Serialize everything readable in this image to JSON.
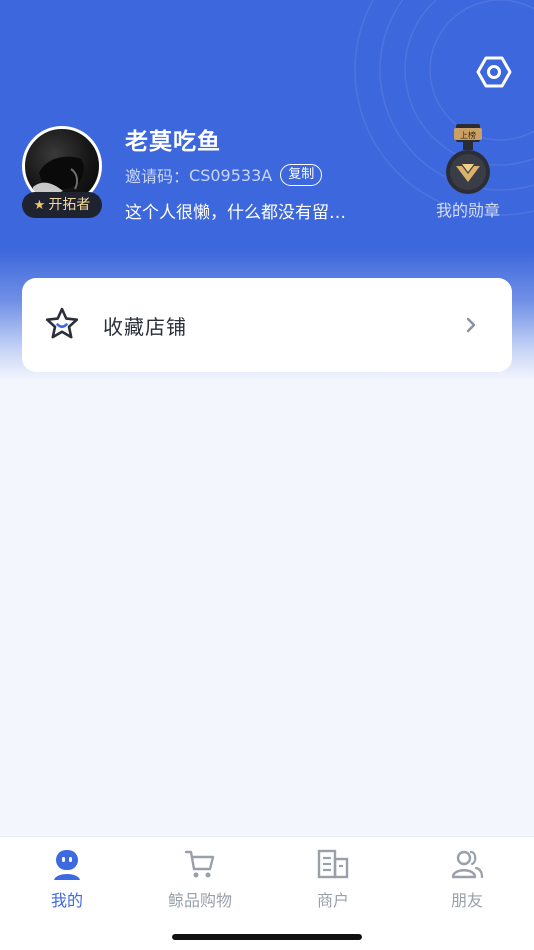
{
  "profile": {
    "name": "老莫吃鱼",
    "invite_label": "邀请码：",
    "invite_code": "CS09533A",
    "copy_label": "复制",
    "bio": "这个人很懒，什么都没有留…",
    "pioneer_badge": "开拓者",
    "medal_tag": "上榜",
    "medal_label": "我的勋章"
  },
  "favorites": {
    "label": "收藏店铺"
  },
  "tabbar": {
    "tabs": [
      {
        "label": "我的",
        "icon": "person-icon",
        "active": true
      },
      {
        "label": "鲸品购物",
        "icon": "cart-icon",
        "active": false
      },
      {
        "label": "商户",
        "icon": "store-icon",
        "active": false
      },
      {
        "label": "朋友",
        "icon": "friends-icon",
        "active": false
      }
    ]
  },
  "colors": {
    "primary": "#3d67dc",
    "accent_active": "#3d6ae0",
    "inactive": "#9aa0ab",
    "background": "#f4f6fd"
  }
}
